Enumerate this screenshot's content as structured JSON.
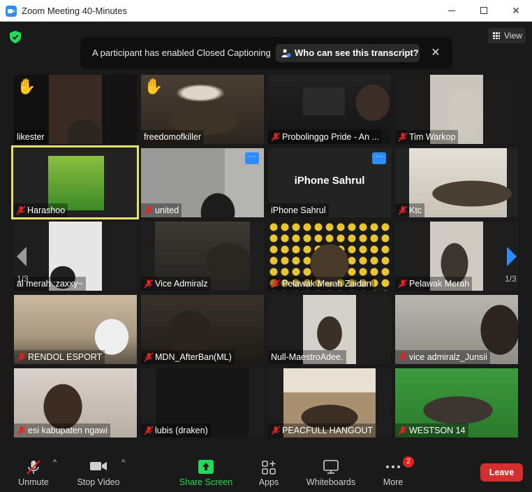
{
  "window": {
    "title": "Zoom Meeting 40-Minutes",
    "minimize_glyph": "",
    "close_glyph": "✕"
  },
  "view_button": {
    "label": "View"
  },
  "banner": {
    "message": "A participant has enabled Closed Captioning",
    "who_button": "Who can see this transcript?",
    "close_glyph": "✕"
  },
  "tiles": [
    {
      "name": "likester",
      "hand": "✋",
      "muted": false
    },
    {
      "name": "freedomofkiller",
      "hand": "✋",
      "muted": false
    },
    {
      "name": "Probolinggo Pride - An ...",
      "muted": true
    },
    {
      "name": "Tim Warkop",
      "muted": true
    },
    {
      "name": "Harashoo",
      "muted": true,
      "active": true
    },
    {
      "name": "united",
      "muted": true,
      "more": "···"
    },
    {
      "name": "iPhone Sahrul",
      "center_name": "iPhone Sahrul",
      "muted": false,
      "more": "···"
    },
    {
      "name": "Ktc",
      "muted": true
    },
    {
      "name": "al merah :zaxxy~",
      "muted": false
    },
    {
      "name": "Vice Admiralz",
      "muted": true
    },
    {
      "name": "Pelawak Merah Zaidan",
      "muted": true
    },
    {
      "name": "Pelawak Merah",
      "muted": true
    },
    {
      "name": "RENDOL ESPORT",
      "muted": true
    },
    {
      "name": "MDN_AfterBan(ML)",
      "muted": true
    },
    {
      "name": "Null-MaestroAdee.",
      "muted": false
    },
    {
      "name": "vice admiralz_Junsii",
      "muted": true
    },
    {
      "name": "esi kabupaten ngawi",
      "muted": true
    },
    {
      "name": "lubis (draken)",
      "muted": true
    },
    {
      "name": "PEACFULL HANGOUT",
      "muted": true
    },
    {
      "name": "WESTSON 14",
      "muted": true
    }
  ],
  "pagination": {
    "left": "1/3",
    "right": "1/3"
  },
  "toolbar": {
    "unmute": "Unmute",
    "stop_video": "Stop Video",
    "share_screen": "Share Screen",
    "apps": "Apps",
    "whiteboards": "Whiteboards",
    "more": "More",
    "more_badge": "2",
    "leave": "Leave",
    "caret": "^"
  },
  "colors": {
    "share_green": "#23d959",
    "leave_red": "#d32f2f",
    "active_border": "#e4e36c",
    "accent_blue": "#2d8cff",
    "mic_off_red": "#e02424"
  }
}
